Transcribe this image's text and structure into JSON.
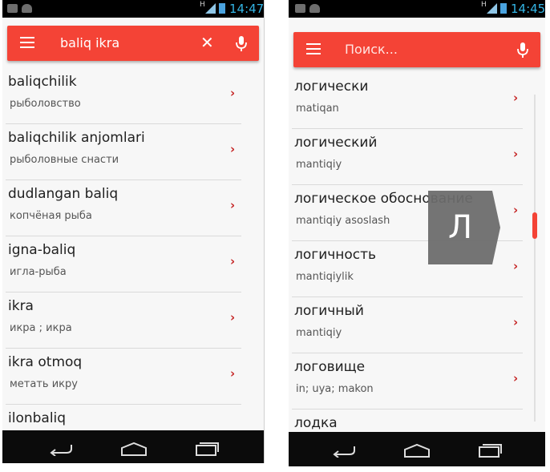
{
  "left": {
    "status": {
      "time": "14:47"
    },
    "search": {
      "value": "baliq ikra"
    },
    "items": [
      {
        "term": "baliqchilik",
        "translation": "рыболовство"
      },
      {
        "term": "baliqchilik anjomlari",
        "translation": "рыболовные снасти"
      },
      {
        "term": "dudlangan baliq",
        "translation": "копчёная рыба"
      },
      {
        "term": "igna-baliq",
        "translation": "игла-рыба"
      },
      {
        "term": "ikra",
        "translation": "икра ; икра"
      },
      {
        "term": "ikra otmoq",
        "translation": "метать икру"
      },
      {
        "term": "ilonbaliq",
        "translation": ""
      }
    ]
  },
  "right": {
    "status": {
      "time": "14:45"
    },
    "search": {
      "placeholder": "Поиск..."
    },
    "index_letter": "Л",
    "items": [
      {
        "term": "логически",
        "translation": "matiqan"
      },
      {
        "term": "логический",
        "translation": "mantiqiy"
      },
      {
        "term": "логическое обоснование",
        "translation": "mantiqiy asoslash"
      },
      {
        "term": "логичность",
        "translation": "mantiqiylik"
      },
      {
        "term": "логичный",
        "translation": "mantiqiy"
      },
      {
        "term": "логовище",
        "translation": "in; uya; makon"
      },
      {
        "term": "лодка",
        "translation": ""
      }
    ]
  },
  "colors": {
    "accent": "#f44336",
    "chevron": "#c62828",
    "status_time": "#33b5e5"
  },
  "icons": [
    "menu-icon",
    "clear-icon",
    "microphone-icon",
    "chevron-right-icon",
    "back-icon",
    "home-icon",
    "recent-apps-icon"
  ]
}
